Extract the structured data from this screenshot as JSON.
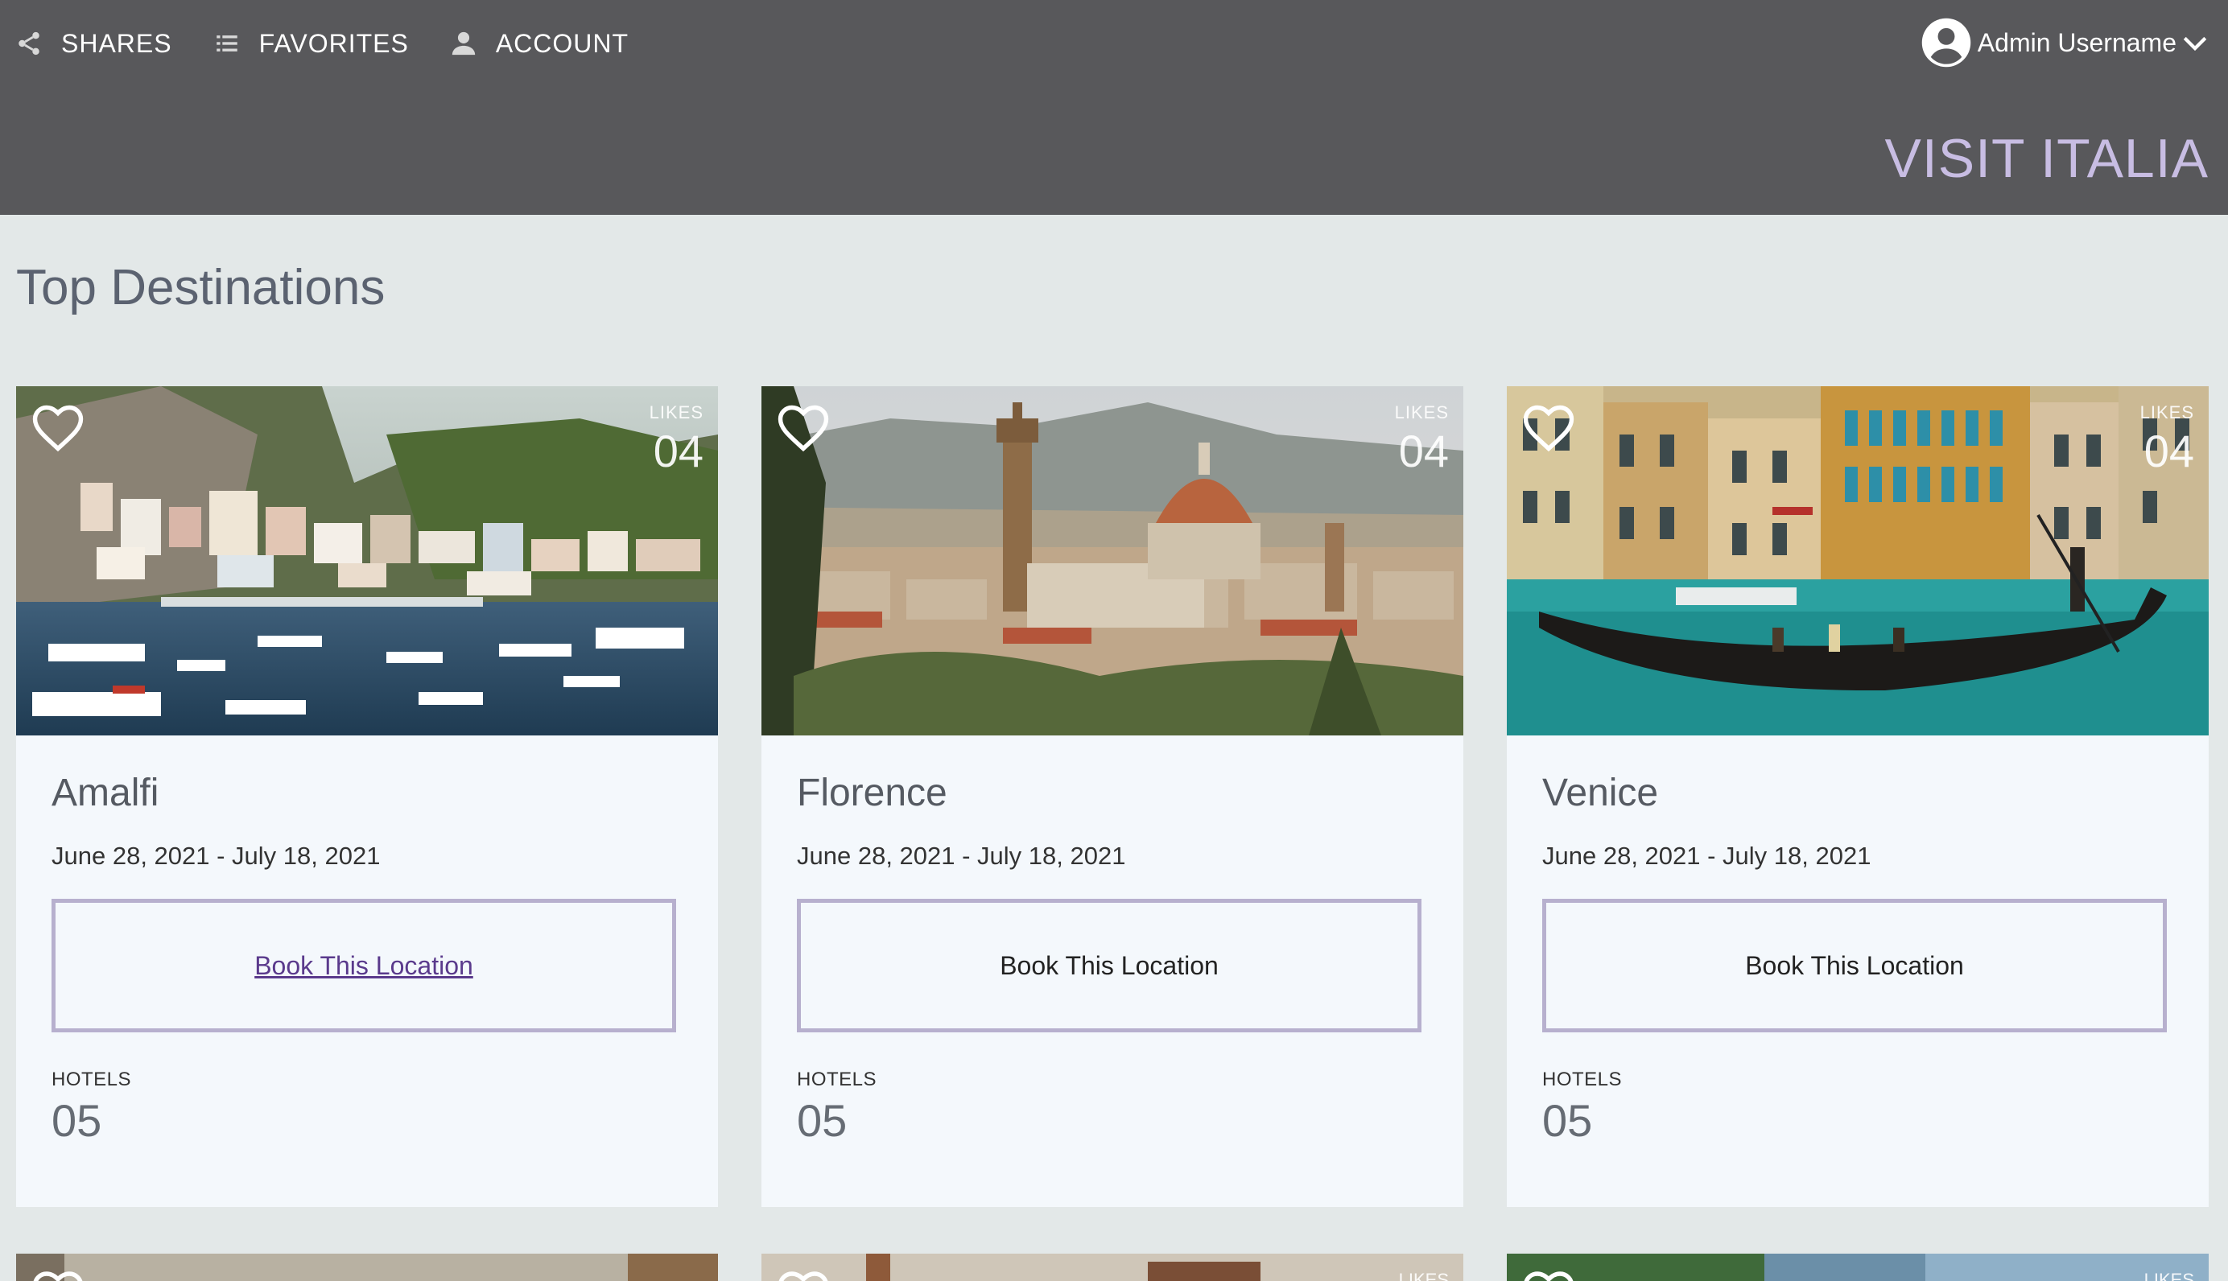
{
  "nav": {
    "items": [
      {
        "label": "SHARES",
        "icon": "share-icon"
      },
      {
        "label": "FAVORITES",
        "icon": "list-icon"
      },
      {
        "label": "ACCOUNT",
        "icon": "person-icon"
      }
    ]
  },
  "user": {
    "name": "Admin Username",
    "icon": "account-circle-icon",
    "menu_icon": "chevron-down-icon"
  },
  "brand": "VISIT ITALIA",
  "section_title": "Top Destinations",
  "cards": [
    {
      "city": "Amalfi",
      "dates": "June 28, 2021 - July 18, 2021",
      "likes_label": "LIKES",
      "likes": "04",
      "book_label": "Book This Location",
      "hotels_label": "HOTELS",
      "hotels": "05"
    },
    {
      "city": "Florence",
      "dates": "June 28, 2021 - July 18, 2021",
      "likes_label": "LIKES",
      "likes": "04",
      "book_label": "Book This Location",
      "hotels_label": "HOTELS",
      "hotels": "05"
    },
    {
      "city": "Venice",
      "dates": "June 28, 2021 - July 18, 2021",
      "likes_label": "LIKES",
      "likes": "04",
      "book_label": "Book This Location",
      "hotels_label": "HOTELS",
      "hotels": "05"
    }
  ],
  "next_row": {
    "likes_label": "LIKES"
  },
  "colors": {
    "header": "#58585b",
    "brand": "#c8bde3",
    "page": "#e3e8e8",
    "card": "#f4f8fc",
    "button_border": "#b7b0ce",
    "link": "#5a3a8c"
  }
}
